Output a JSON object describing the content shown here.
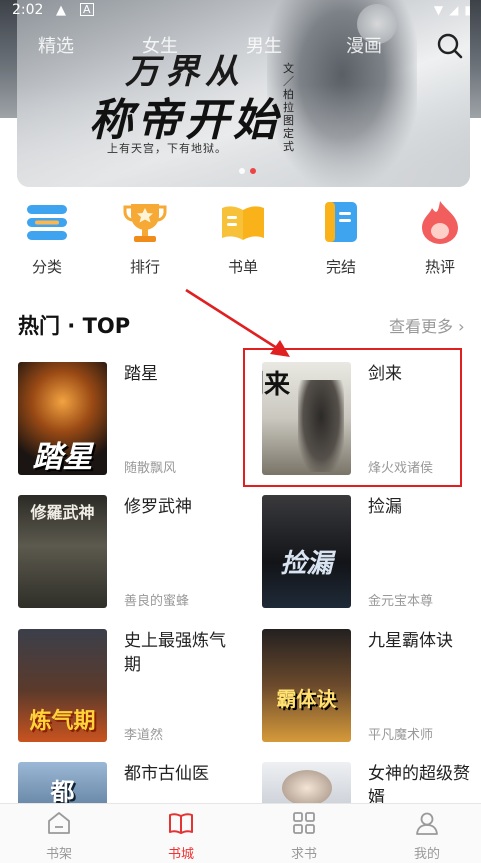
{
  "status_bar": {
    "time": "2:02"
  },
  "top_tabs": [
    "精选",
    "女生",
    "男生",
    "漫画"
  ],
  "banner": {
    "title_line1": "万界从",
    "title_line2": "称帝开始",
    "author_vertical": "文／柏拉图定式",
    "subtitle": "上有天宫，下有地狱。",
    "page_count": 2,
    "active_page": 1
  },
  "categories": [
    {
      "label": "分类",
      "icon": "list-icon"
    },
    {
      "label": "排行",
      "icon": "trophy-icon"
    },
    {
      "label": "书单",
      "icon": "book-list-icon"
    },
    {
      "label": "完结",
      "icon": "bookmark-icon"
    },
    {
      "label": "热评",
      "icon": "flame-icon"
    }
  ],
  "section": {
    "title": "热门 · TOP",
    "more": "查看更多 ›"
  },
  "books": [
    {
      "name": "踏星",
      "author": "随散飘风",
      "cover_text": "踏星"
    },
    {
      "name": "剑来",
      "author": "烽火戏诸侯",
      "cover_text": "剑来"
    },
    {
      "name": "修罗武神",
      "author": "善良的蜜蜂",
      "cover_text": "修羅武神"
    },
    {
      "name": "捡漏",
      "author": "金元宝本尊",
      "cover_text": "捡漏"
    },
    {
      "name": "史上最强炼气期",
      "author": "李道然",
      "cover_text": "炼气期"
    },
    {
      "name": "九星霸体诀",
      "author": "平凡魔术师",
      "cover_text": "霸体诀"
    },
    {
      "name": "都市古仙医",
      "author": "",
      "cover_text": "都"
    },
    {
      "name": "女神的超级赘婿",
      "author": "",
      "cover_text": ""
    }
  ],
  "bottom_nav": [
    {
      "label": "书架",
      "icon": "bookshelf-icon"
    },
    {
      "label": "书城",
      "icon": "open-book-icon"
    },
    {
      "label": "求书",
      "icon": "grid-icon"
    },
    {
      "label": "我的",
      "icon": "user-icon"
    }
  ],
  "colors": {
    "accent": "#e33333",
    "highlight": "#e02020",
    "muted": "#999999"
  }
}
